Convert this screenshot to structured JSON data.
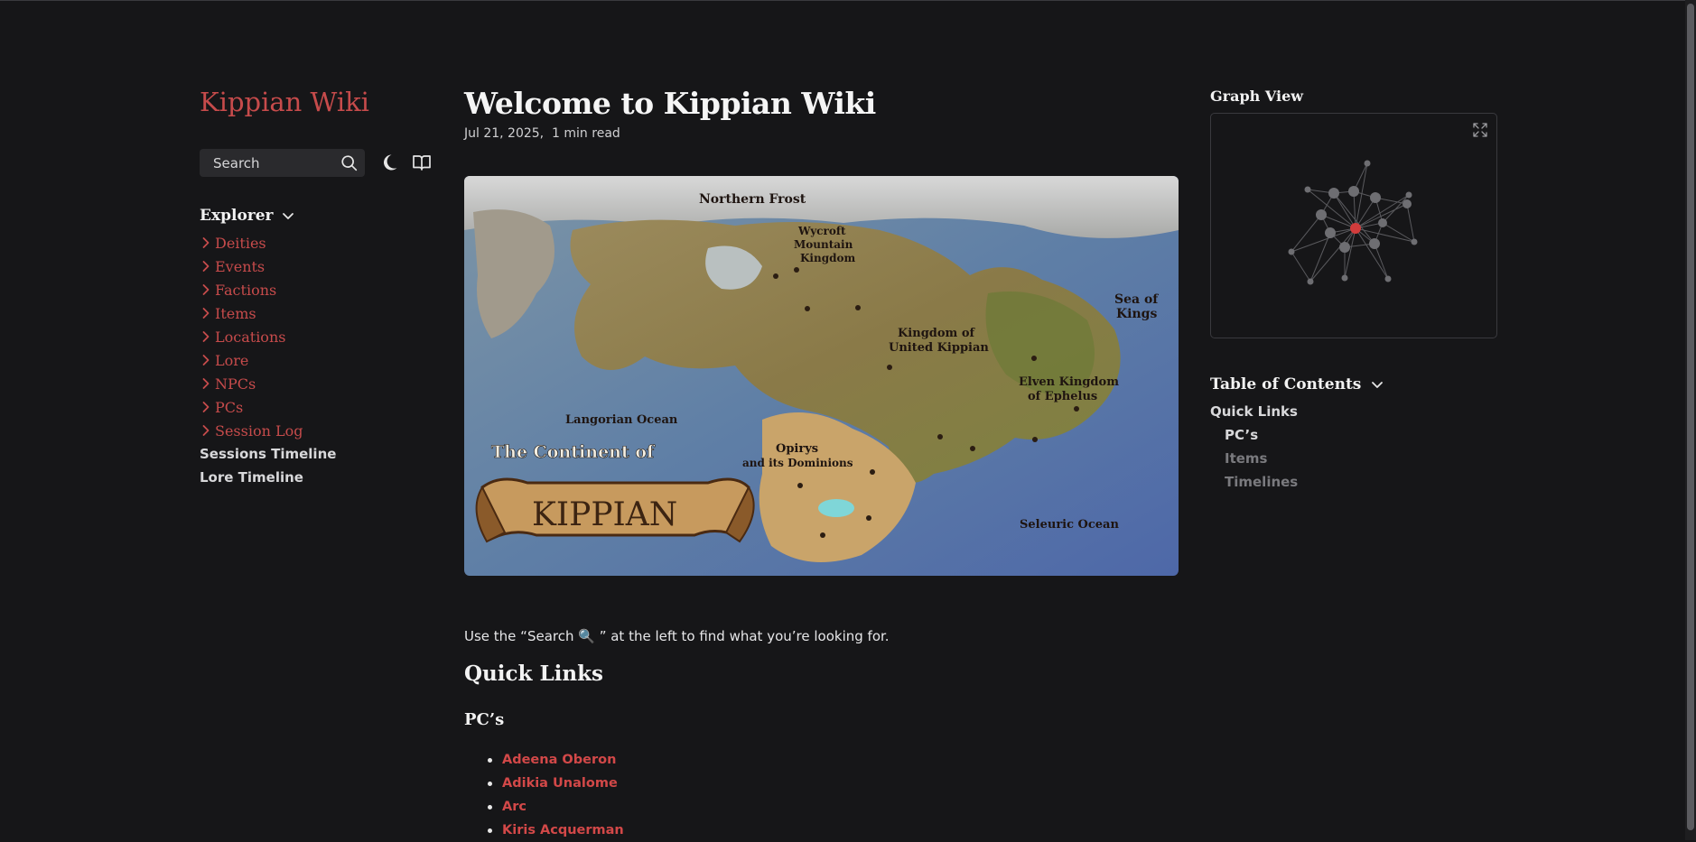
{
  "site": {
    "title": "Kippian Wiki"
  },
  "search": {
    "label": "Search"
  },
  "explorer": {
    "title": "Explorer",
    "folders": [
      "Deities",
      "Events",
      "Factions",
      "Items",
      "Locations",
      "Lore",
      "NPCs",
      "PCs",
      "Session Log"
    ],
    "links": [
      "Sessions Timeline",
      "Lore Timeline"
    ]
  },
  "page": {
    "title": "Welcome to Kippian Wiki",
    "date": "Jul 21, 2025,",
    "read_time": "1 min read",
    "intro": "Use the “Search 🔍 ” at the left to find what you’re looking for.",
    "h2": "Quick Links",
    "h3": "PC’s",
    "pcs": [
      "Adeena Oberon",
      "Adikia Unalome",
      "Arc",
      "Kiris Acquerman"
    ]
  },
  "map": {
    "title_line1": "The Continent of",
    "title_banner": "KIPPIAN",
    "labels": {
      "northern_frost": "Northern Frost",
      "wycroft": "Wycroft",
      "mountain": "Mountain",
      "kingdom": "Kingdom",
      "kingdom_united_1": "Kingdom of",
      "kingdom_united_2": "United Kippian",
      "elven_1": "Elven Kingdom",
      "elven_2": "of Ephelus",
      "sea_of": "Sea of",
      "kings": "Kings",
      "langorian": "Langorian Ocean",
      "seleuric": "Seleuric Ocean",
      "opirys_1": "Opirys",
      "opirys_2": "and its Dominions"
    }
  },
  "graph": {
    "title": "Graph View"
  },
  "toc": {
    "title": "Table of Contents",
    "items": [
      {
        "label": "Quick Links",
        "level": 1,
        "dim": false
      },
      {
        "label": "PC’s",
        "level": 2,
        "dim": false
      },
      {
        "label": "Items",
        "level": 2,
        "dim": true
      },
      {
        "label": "Timelines",
        "level": 2,
        "dim": true
      }
    ]
  },
  "colors": {
    "accent": "#c64b4b",
    "background": "#161618",
    "graph_active": "#d23c3c"
  },
  "icons": [
    "search-icon",
    "moon-icon",
    "book-icon",
    "chevron-down-icon",
    "chevron-right-icon",
    "expand-icon"
  ]
}
